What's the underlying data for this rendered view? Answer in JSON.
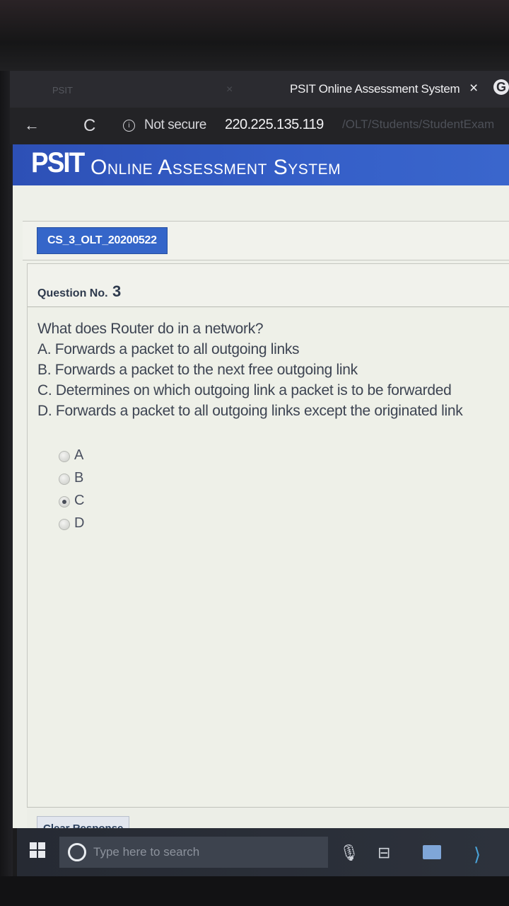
{
  "browser": {
    "inactive_tab_title": "PSIT",
    "active_tab_title": "PSIT Online Assessment System",
    "tab_close": "×",
    "back": "←",
    "reload": "C",
    "security_label": "Not secure",
    "url_host": "220.225.135.119",
    "url_path": "/OLT/Students/StudentExam"
  },
  "app": {
    "logo_bold": "PSIT",
    "logo_rest": "Online Assessment System"
  },
  "test": {
    "code": "CS_3_OLT_20200522"
  },
  "question": {
    "label": "Question No.",
    "number": "3",
    "lines": [
      "What does Router do in a network?",
      "A. Forwards a packet to all outgoing links",
      "B. Forwards a packet to the next free outgoing link",
      "C. Determines on which outgoing link a packet is to be forwarded",
      "D. Forwards a packet to all outgoing links except the originated link"
    ],
    "options": [
      "A",
      "B",
      "C",
      "D"
    ],
    "selected": "C"
  },
  "footer": {
    "clear_label": "Clear Response"
  },
  "taskbar": {
    "search_placeholder": "Type here to search"
  }
}
